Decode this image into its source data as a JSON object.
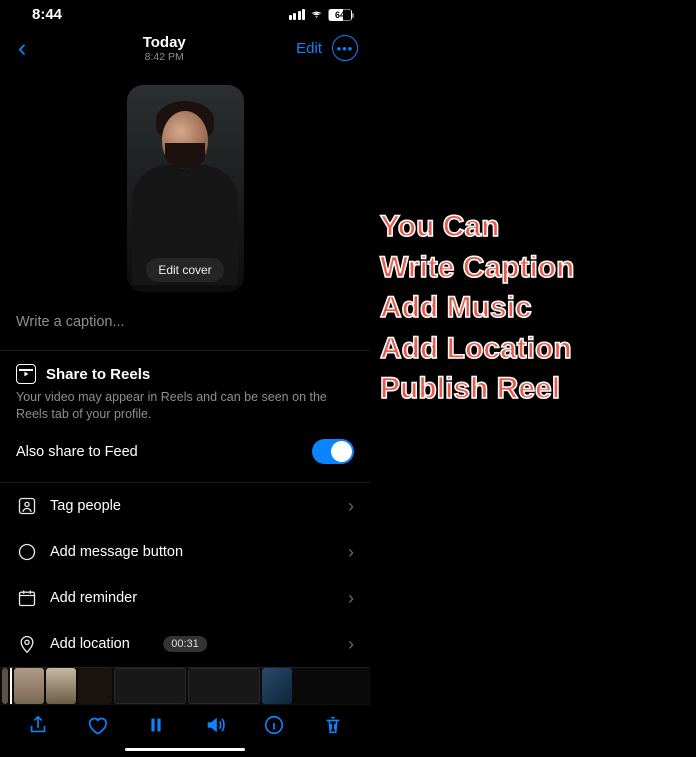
{
  "status": {
    "time": "8:44",
    "battery_pct": "64"
  },
  "nav": {
    "title": "Today",
    "subtitle": "8:42 PM",
    "edit_label": "Edit"
  },
  "cover": {
    "edit_cover_label": "Edit cover"
  },
  "caption": {
    "placeholder": "Write a caption..."
  },
  "share_reels": {
    "title": "Share to Reels",
    "description": "Your video may appear in Reels and can be seen on the Reels tab of your profile.",
    "feed_toggle_label": "Also share to Feed"
  },
  "options": {
    "tag_people": "Tag people",
    "add_message_button": "Add message button",
    "add_reminder": "Add reminder",
    "add_location": "Add location"
  },
  "timeline": {
    "timecode": "00:31"
  },
  "annotation": {
    "line1": "You Can",
    "line2": "Write Caption",
    "line3": "Add Music",
    "line4": "Add Location",
    "line5": "Publish Reel"
  }
}
